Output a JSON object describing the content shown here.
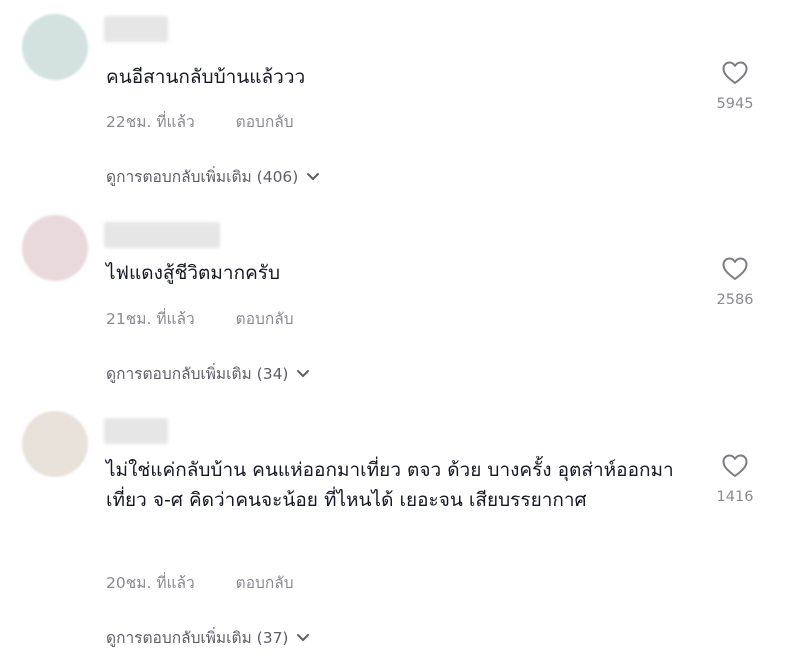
{
  "comments": [
    {
      "text": "คนอีสานกลับบ้านแล้ววว",
      "time": "22ชม. ที่แล้ว",
      "reply_label": "ตอบกลับ",
      "more_replies": "ดูการตอบกลับเพิ่มเติม (406)",
      "likes": "5945",
      "avatar_color": "#d3e2df"
    },
    {
      "text": "ไฟแดงสู้ชีวิตมากครับ",
      "time": "21ชม. ที่แล้ว",
      "reply_label": "ตอบกลับ",
      "more_replies": "ดูการตอบกลับเพิ่มเติม (34)",
      "likes": "2586",
      "avatar_color": "#ead9dc"
    },
    {
      "text": "ไม่ใช่แค่กลับบ้าน คนแห่ออกมาเที่ยว ตจว ด้วย บางครั้ง อุตส่าห์ออกมาเที่ยว จ-ศ คิดว่าคนจะน้อย ที่ไหนได้ เยอะจน เสียบรรยากาศ",
      "time": "20ชม. ที่แล้ว",
      "reply_label": "ตอบกลับ",
      "more_replies": "ดูการตอบกลับเพิ่มเติม (37)",
      "likes": "1416",
      "avatar_color": "#e8e2da"
    }
  ]
}
